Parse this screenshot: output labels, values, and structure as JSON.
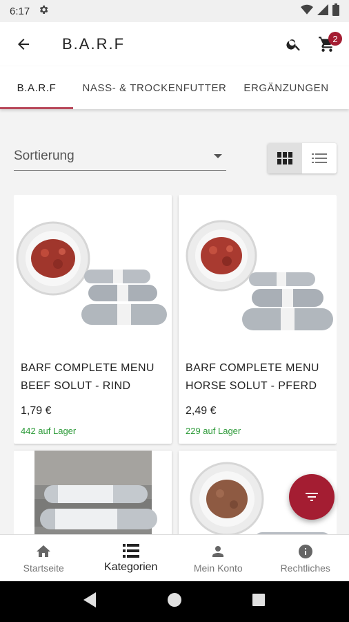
{
  "status_bar": {
    "time": "6:17",
    "icons": [
      "settings-icon",
      "wifi-icon",
      "signal-icon",
      "battery-icon"
    ]
  },
  "app_bar": {
    "title": "B.A.R.F",
    "back_icon": "arrow-back-icon",
    "search_icon": "search-icon",
    "cart_icon": "cart-icon",
    "cart_count": "2"
  },
  "tabs": [
    {
      "label": "B.A.R.F",
      "active": true
    },
    {
      "label": "NASS- & TROCKENFUTTER",
      "active": false
    },
    {
      "label": "ERGÄNZUNGEN",
      "active": false
    }
  ],
  "sort": {
    "label": "Sortierung"
  },
  "view_toggle": {
    "grid_icon": "grid-view-icon",
    "list_icon": "list-view-icon",
    "active": "grid"
  },
  "products": [
    {
      "name": "BARF COMPLETE MENU BEEF SOLUT - RIND",
      "price": "1,79 €",
      "stock": "442 auf Lager"
    },
    {
      "name": "BARF COMPLETE MENU HORSE SOLUT - PFERD",
      "price": "2,49 €",
      "stock": "229 auf Lager"
    },
    {
      "name": "",
      "price": "",
      "stock": ""
    },
    {
      "name": "",
      "price": "",
      "stock": ""
    }
  ],
  "fab": {
    "icon": "filter-icon"
  },
  "bottom_nav": [
    {
      "label": "Startseite",
      "icon": "home-icon",
      "active": false
    },
    {
      "label": "Kategorien",
      "icon": "list-icon",
      "active": true
    },
    {
      "label": "Mein Konto",
      "icon": "person-icon",
      "active": false
    },
    {
      "label": "Rechtliches",
      "icon": "info-icon",
      "active": false
    }
  ],
  "colors": {
    "accent": "#a41d32",
    "tab_indicator": "#b8485a",
    "stock_green": "#2c9a38"
  }
}
